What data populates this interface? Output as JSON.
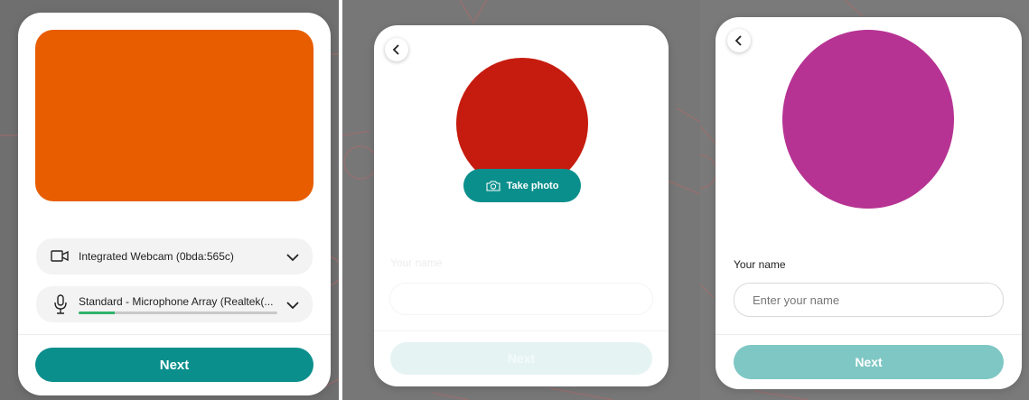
{
  "device_setup": {
    "camera_label": "Integrated Webcam (0bda:565c)",
    "microphone_label": "Standard - Microphone Array (Realtek(...",
    "mic_level": 0.18,
    "next_label": "Next"
  },
  "photo_step": {
    "take_photo_label": "Take photo",
    "name_label": "Your name",
    "next_label": "Next"
  },
  "name_step": {
    "name_label": "Your name",
    "name_placeholder": "Enter your name",
    "next_label": "Next"
  },
  "colors": {
    "video_preview": "#e85d00",
    "photo_avatar": "#c61c0f",
    "final_avatar": "#b63393",
    "teal": "#0b8f8c",
    "teal_disabled": "#7fc7c4",
    "teal_faded": "#e6f3f3"
  }
}
